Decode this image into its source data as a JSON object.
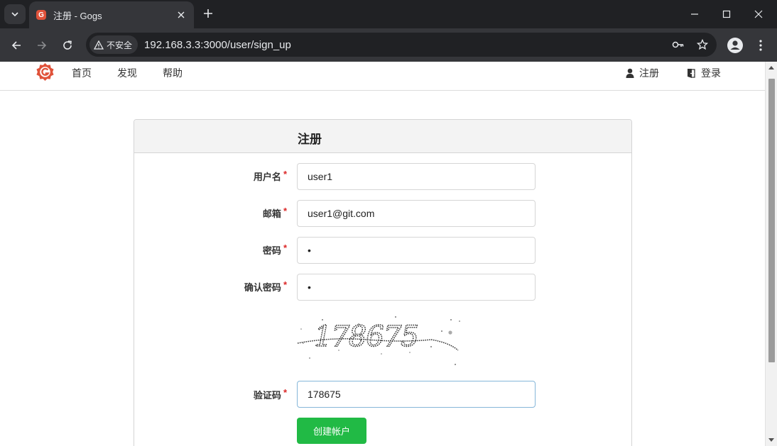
{
  "browser": {
    "tab_title": "注册 - Gogs",
    "favicon_letter": "G",
    "security_label": "不安全",
    "url": "192.168.3.3:3000/user/sign_up"
  },
  "site": {
    "nav": {
      "home": "首页",
      "explore": "发现",
      "help": "帮助"
    },
    "nav_right": {
      "register": "注册",
      "login": "登录"
    }
  },
  "form": {
    "title": "注册",
    "required_mark": "*",
    "username": {
      "label": "用户名",
      "value": "user1"
    },
    "email": {
      "label": "邮箱",
      "value": "user1@git.com"
    },
    "password": {
      "label": "密码",
      "value": "•"
    },
    "confirm_password": {
      "label": "确认密码",
      "value": "•"
    },
    "captcha": {
      "label": "验证码",
      "image_text": "178675",
      "value": "178675"
    },
    "submit_label": "创建帐户"
  },
  "colors": {
    "accent_green": "#21ba45",
    "required_red": "#db2828",
    "gogs_brand": "#e0523a"
  }
}
